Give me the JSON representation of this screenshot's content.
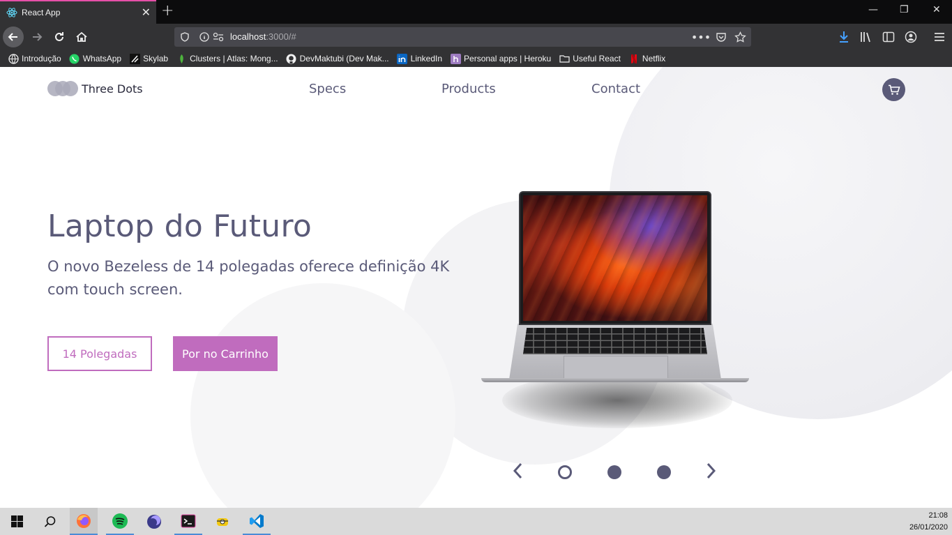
{
  "browser": {
    "tab_title": "React App",
    "url_host": "localhost",
    "url_rest": ":3000/#",
    "bookmarks": [
      "Introdução",
      "WhatsApp",
      "Skylab",
      "Clusters | Atlas: Mong...",
      "DevMaktubi (Dev Mak...",
      "LinkedIn",
      "Personal apps | Heroku",
      "Useful React",
      "Netflix"
    ]
  },
  "site": {
    "brand": "Three Dots",
    "nav": [
      "Specs",
      "Products",
      "Contact"
    ]
  },
  "hero": {
    "title": "Laptop do Futuro",
    "subtitle": "O novo Bezeless de 14 polegadas oferece definição 4K com touch screen.",
    "btn_outline": "14 Polegadas",
    "btn_solid": "Por no Carrinho"
  },
  "colors": {
    "accent": "#c06cbe",
    "text": "#5a5a78"
  },
  "carousel": {
    "active_index": 0,
    "count": 3
  },
  "taskbar": {
    "time": "21:08",
    "date": "26/01/2020"
  }
}
